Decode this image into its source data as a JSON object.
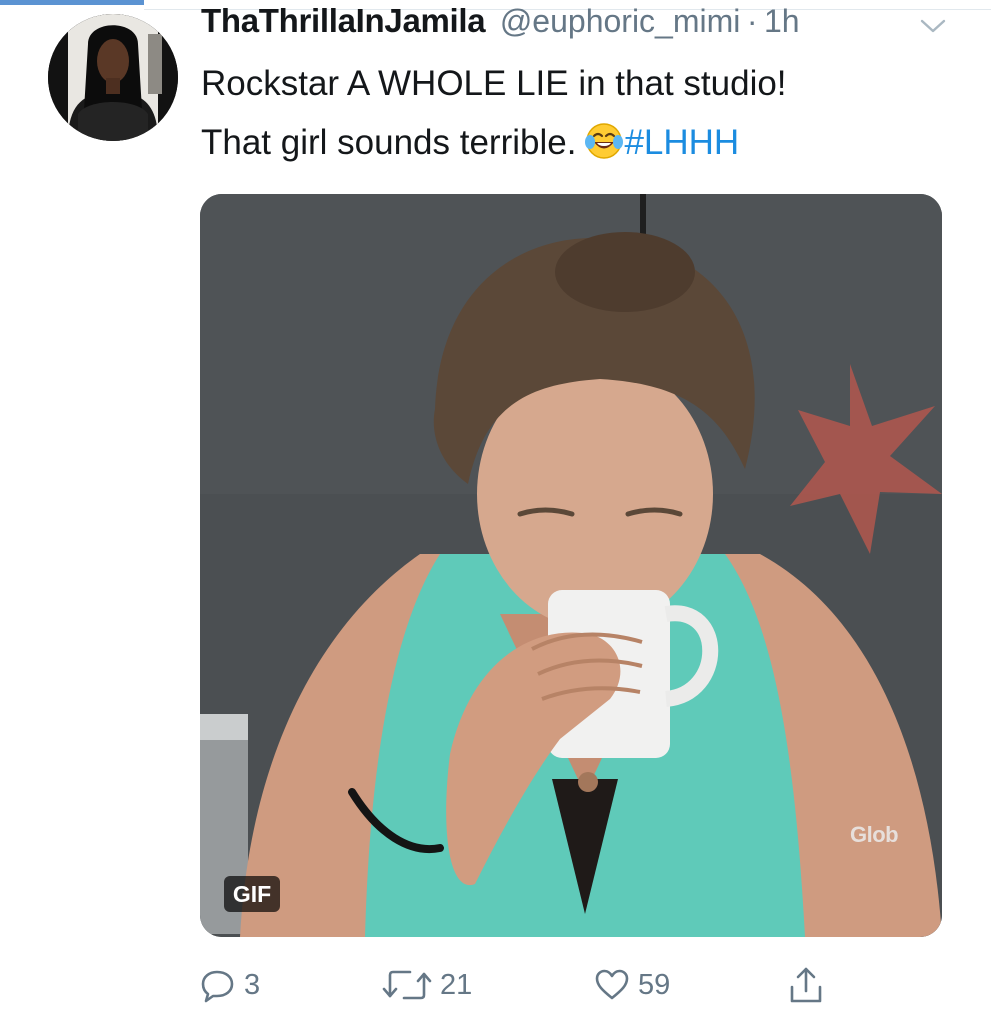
{
  "tweet": {
    "author_name": "ThaThrillaInJamila",
    "handle": "@euphoric_mimi",
    "separator": "·",
    "time": "1h",
    "text_line1": "Rockstar A WHOLE LIE in that studio!",
    "text_line2": "That girl sounds terrible.",
    "hashtag": "#LHHH",
    "emoji": "face-with-tears-of-joy"
  },
  "media": {
    "badge": "GIF",
    "watermark": "Glob"
  },
  "actions": {
    "reply_count": "3",
    "retweet_count": "21",
    "like_count": "59"
  },
  "icons": {
    "reply": "reply-icon",
    "retweet": "retweet-icon",
    "like": "heart-icon",
    "share": "share-icon",
    "menu": "chevron-down-icon"
  },
  "colors": {
    "accent": "#1b8ce0",
    "secondary_text": "#657786",
    "primary_text": "#14171a"
  }
}
